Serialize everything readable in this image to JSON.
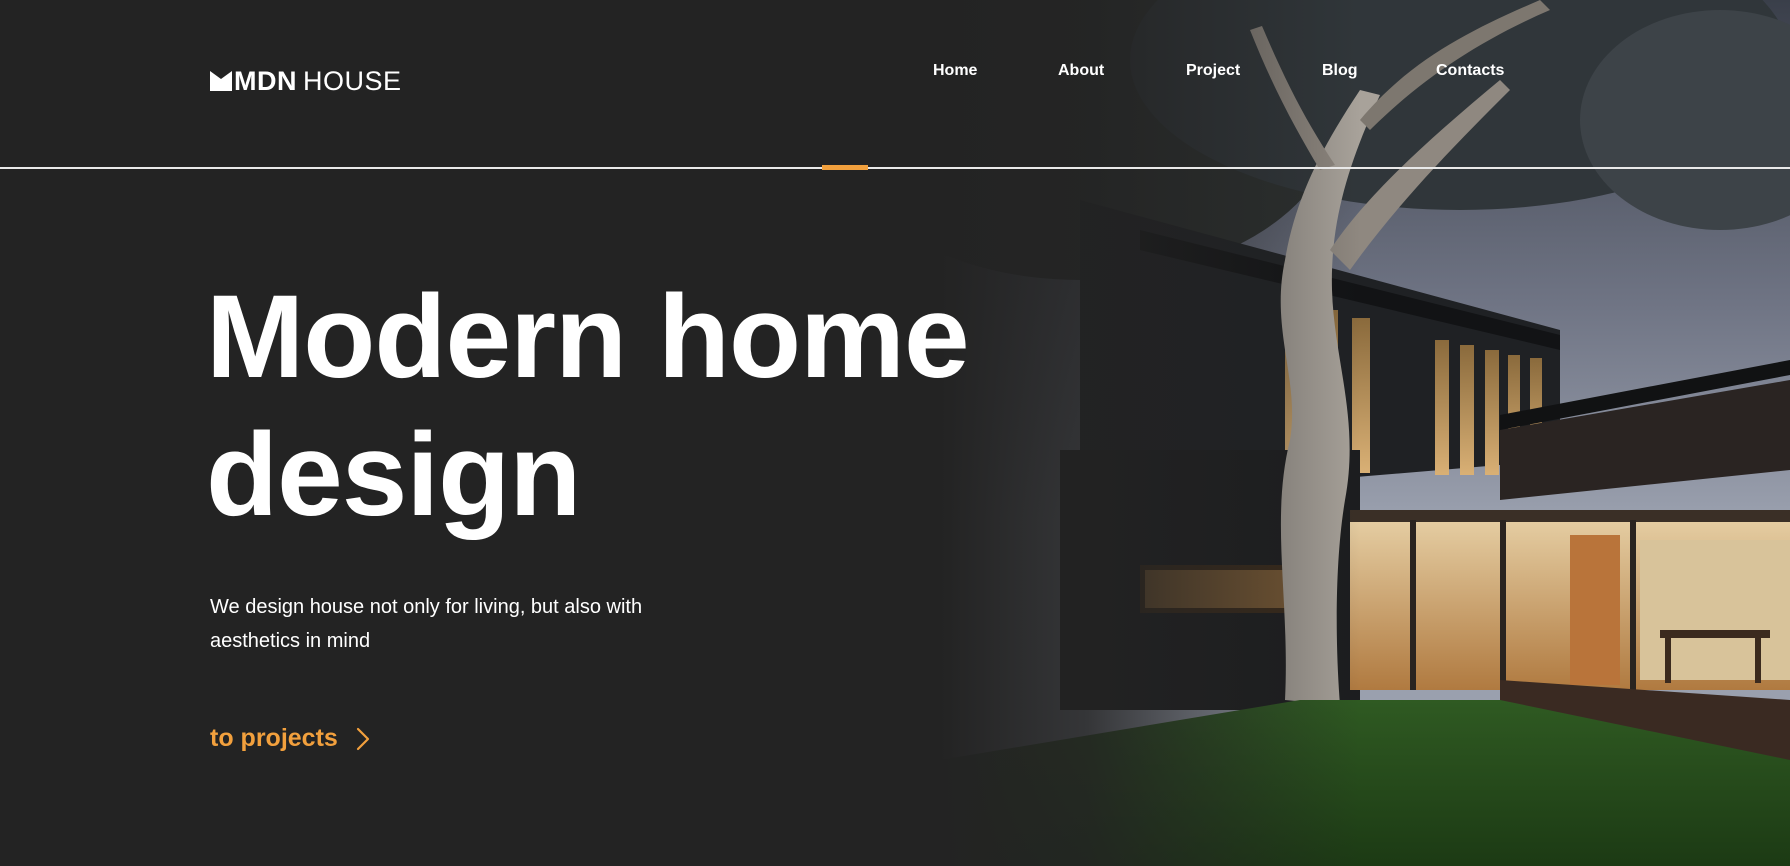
{
  "brand": {
    "name_bold": "MDN",
    "name_light": "HOUSE",
    "logo_icon": "crown-m-icon"
  },
  "nav": {
    "items": [
      {
        "label": "Home"
      },
      {
        "label": "About"
      },
      {
        "label": "Project"
      },
      {
        "label": "Blog"
      },
      {
        "label": "Contacts"
      }
    ]
  },
  "hero": {
    "title_line1": "Modern home",
    "title_line2": "design",
    "subtitle": "We design house not only for living, but also with aesthetics in mind",
    "cta_label": "to projects",
    "cta_icon": "chevron-right-icon",
    "photo": "modern-house-night-photo"
  },
  "colors": {
    "background": "#232323",
    "text": "#ffffff",
    "accent": "#f2a03d",
    "divider": "#e9e9e9"
  }
}
